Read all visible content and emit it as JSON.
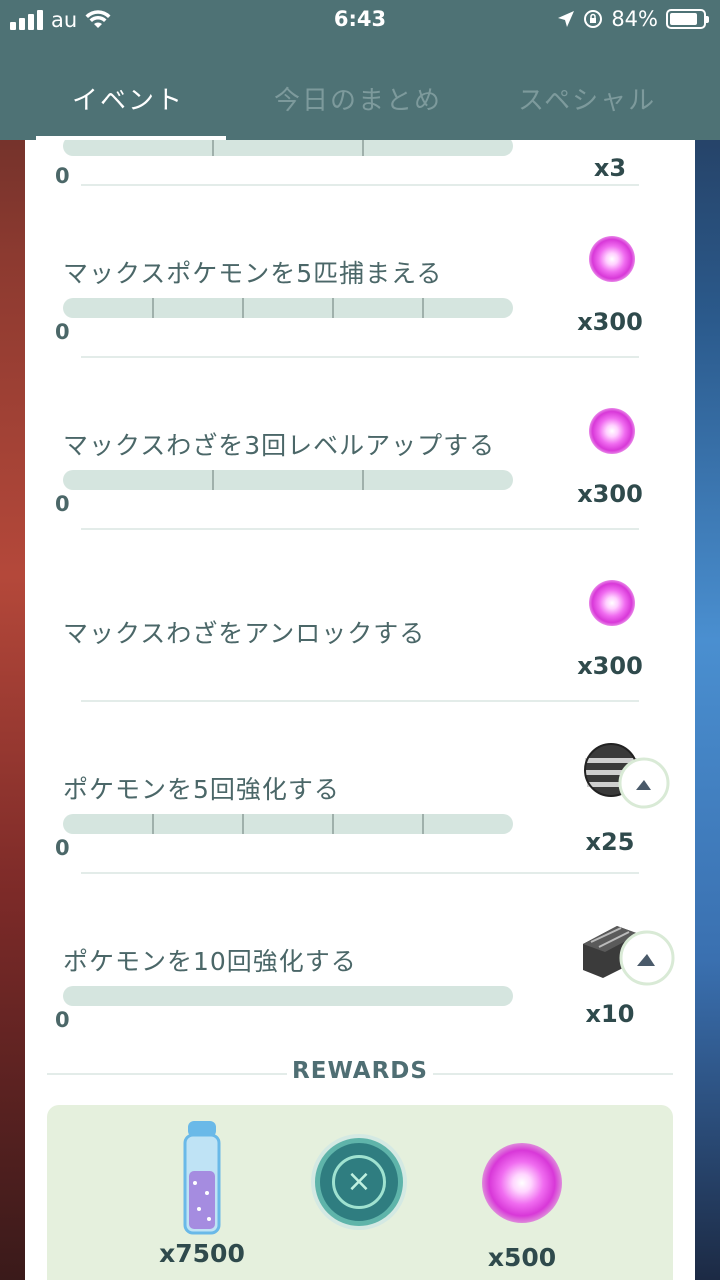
{
  "status_bar": {
    "carrier": "au",
    "time": "6:43",
    "battery": "84%",
    "battery_level": 0.84
  },
  "tabs": [
    {
      "label": "イベント",
      "active": true
    },
    {
      "label": "今日のまとめ",
      "active": false
    },
    {
      "label": "スペシャル",
      "active": false
    }
  ],
  "tasks": [
    {
      "title": "",
      "count": "0",
      "progress": 0,
      "reward_icon": "max-particle-icon",
      "reward_qty": "x3",
      "segments": 3
    },
    {
      "title": "マックスポケモンを5匹捕まえる",
      "count": "0",
      "progress": 0,
      "reward_icon": "max-particle-icon",
      "reward_qty": "x300",
      "segments": 5
    },
    {
      "title": "マックスわざを3回レベルアップする",
      "count": "0",
      "progress": 0,
      "reward_icon": "max-particle-icon",
      "reward_qty": "x300",
      "segments": 3
    },
    {
      "title": "マックスわざをアンロックする",
      "count": "",
      "progress": null,
      "reward_icon": "max-particle-icon",
      "reward_qty": "x300",
      "segments": 0
    },
    {
      "title": "ポケモンを5回強化する",
      "count": "0",
      "progress": 0,
      "reward_icon": "heavy-ball-icon",
      "reward_qty": "x25",
      "segments": 5
    },
    {
      "title": "ポケモンを10回強化する",
      "count": "0",
      "progress": 0,
      "reward_icon": "ball-case-icon",
      "reward_qty": "x10",
      "segments": 1
    }
  ],
  "rewards": {
    "title": "REWARDS",
    "items": [
      {
        "icon": "stardust-bottle-icon",
        "qty": "x7500"
      },
      {
        "icon": "max-particle-icon",
        "qty": "x500"
      }
    ],
    "close_icon": "close-icon"
  },
  "colors": {
    "header": "#4e7275",
    "card": "#ffffff",
    "progress_track": "#d5e5df",
    "rewards_box": "#e5f0dd",
    "max_particle": "#e050e0"
  }
}
